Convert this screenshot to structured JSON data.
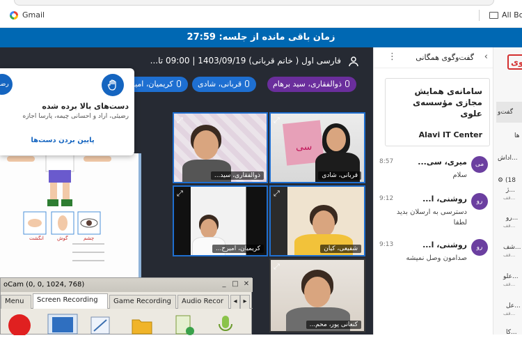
{
  "browser": {
    "bookmark_gmail": "Gmail",
    "bookmark_all": "All Bo"
  },
  "timer": {
    "text": "زمان باقی مانده از جلسه: 27:59"
  },
  "meeting": {
    "title": "فارسی اول ( خانم قربانی) 1403/09/19 | 09:00 تا...",
    "chips": [
      {
        "label": "ذوالفقاری، سید برهام",
        "color": "#6a2e9c"
      },
      {
        "label": "قربانی، شادی",
        "color": "#1e6fd1"
      },
      {
        "label": "کریمیان، امیر",
        "color": "#1e6fd1"
      }
    ],
    "tiles": [
      {
        "name": "قربانی، شادی"
      },
      {
        "name": "ذوالفقاری، سید..."
      },
      {
        "name": "شفیعی، کیان"
      },
      {
        "name": "کریمیان، امیرح..."
      },
      {
        "name": "کنعانی پور، محم..."
      }
    ]
  },
  "hands_popup": {
    "left_btn": "رضی",
    "title": "دست‌های بالا برده شده",
    "names": "رضیئی، آراد و احسانی چیمه، پارسا اجازه",
    "lower_label": "پایین بردن دست‌ها"
  },
  "book": {
    "label1": "چشم",
    "label2": "گوش",
    "label3": "انگشت"
  },
  "ocam": {
    "title": "oCam (0, 0, 1024, 768)",
    "min": "_",
    "max": "□",
    "close": "✕",
    "tabs": [
      "Menu",
      "Screen Recording",
      "Game Recording",
      "Audio Recor"
    ],
    "scroll_left": "◂",
    "scroll_right": "▸"
  },
  "chat": {
    "title": "گفت‌وگوی همگانی",
    "back_icon": "‹",
    "menu_icon": "⋮",
    "pinned_text": "سامانه‌ی همایش مجازی مؤسسه‌ی علوی",
    "pinned_sub": "Alavi IT Center",
    "messages": [
      {
        "avatar": "می",
        "who": "میری، سی...",
        "time": "8:57",
        "text": "سلام",
        "color": "#6b3fa0"
      },
      {
        "avatar": "رو",
        "who": "روشنی، ا...",
        "time": "9:12",
        "text": "دسترسی به ارسلان بدید لطفا",
        "color": "#6b3fa0"
      },
      {
        "avatar": "رو",
        "who": "روشنی، ا...",
        "time": "9:13",
        "text": "صدامون وصل نمیشه",
        "color": "#6b3fa0"
      }
    ]
  },
  "right_sidebar": {
    "logo": "وی",
    "items": [
      "گفت‌و",
      "ها",
      "اداش...",
      "(18",
      "ژ...",
      "رو...",
      "شف...",
      "علو...",
      "عل...",
      "کا..."
    ],
    "subs": [
      "فف...",
      "فف...",
      "فف...",
      "فف...",
      "فف..."
    ]
  }
}
